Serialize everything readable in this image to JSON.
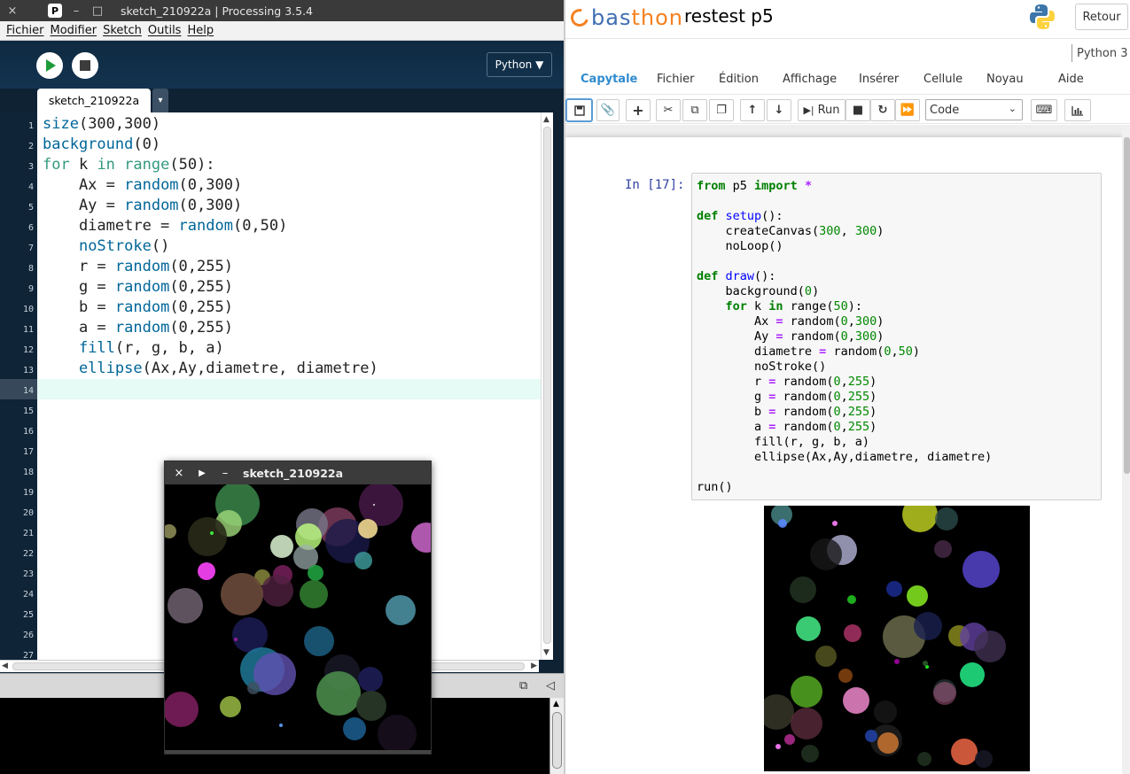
{
  "processing": {
    "window_title": "sketch_210922a | Processing 3.5.4",
    "logo_letter": "P",
    "titlebar_controls": [
      "×",
      "–",
      "□"
    ],
    "menu": [
      "Fichier",
      "Modifier",
      "Sketch",
      "Outils",
      "Help"
    ],
    "mode_label": "Python ▼",
    "tab_name": "sketch_210922a",
    "tab_arrow": "▾",
    "line_numbers": [
      "1",
      "2",
      "3",
      "4",
      "5",
      "6",
      "7",
      "8",
      "9",
      "10",
      "11",
      "12",
      "13",
      "14",
      "15",
      "16",
      "17",
      "18",
      "19",
      "20",
      "21",
      "22",
      "23",
      "24",
      "25",
      "26",
      "27"
    ],
    "code": [
      {
        "parts": [
          [
            "fn",
            "size"
          ],
          [
            "",
            "(300,300)"
          ]
        ]
      },
      {
        "parts": [
          [
            "fn",
            "background"
          ],
          [
            "",
            "(0)"
          ]
        ]
      },
      {
        "parts": [
          [
            "kw",
            "for"
          ],
          [
            "",
            " k "
          ],
          [
            "kw",
            "in"
          ],
          [
            "",
            " "
          ],
          [
            "kw",
            "range"
          ],
          [
            "",
            "(50):"
          ]
        ]
      },
      {
        "parts": [
          [
            "",
            "    Ax = "
          ],
          [
            "fn",
            "random"
          ],
          [
            "",
            "(0,300)"
          ]
        ]
      },
      {
        "parts": [
          [
            "",
            "    Ay = "
          ],
          [
            "fn",
            "random"
          ],
          [
            "",
            "(0,300)"
          ]
        ]
      },
      {
        "parts": [
          [
            "",
            "    diametre = "
          ],
          [
            "fn",
            "random"
          ],
          [
            "",
            "(0,50)"
          ]
        ]
      },
      {
        "parts": [
          [
            "",
            "    "
          ],
          [
            "fn",
            "noStroke"
          ],
          [
            "",
            "()"
          ]
        ]
      },
      {
        "parts": [
          [
            "",
            "    r = "
          ],
          [
            "fn",
            "random"
          ],
          [
            "",
            "(0,255)"
          ]
        ]
      },
      {
        "parts": [
          [
            "",
            "    g = "
          ],
          [
            "fn",
            "random"
          ],
          [
            "",
            "(0,255)"
          ]
        ]
      },
      {
        "parts": [
          [
            "",
            "    b = "
          ],
          [
            "fn",
            "random"
          ],
          [
            "",
            "(0,255)"
          ]
        ]
      },
      {
        "parts": [
          [
            "",
            "    a = "
          ],
          [
            "fn",
            "random"
          ],
          [
            "",
            "(0,255)"
          ]
        ]
      },
      {
        "parts": [
          [
            "",
            "    "
          ],
          [
            "fn",
            "fill"
          ],
          [
            "",
            "(r, g, b, a)"
          ]
        ]
      },
      {
        "parts": [
          [
            "",
            "    "
          ],
          [
            "fn",
            "ellipse"
          ],
          [
            "",
            "(Ax,Ay,diametre, diametre)"
          ]
        ]
      }
    ],
    "sketch_window_title": "sketch_210922a",
    "sketch_controls": [
      "×",
      "▶",
      "–"
    ],
    "console_icons": [
      "⧉",
      "◁"
    ]
  },
  "basthon": {
    "logo_part1": "bas",
    "logo_part2": "thon",
    "notebook_title": "restest p5",
    "retour_label": "Retour",
    "kernel": "Python 3",
    "menu": [
      {
        "label": "Capytale",
        "active": true
      },
      {
        "label": "Fichier"
      },
      {
        "label": "Édition"
      },
      {
        "label": "Affichage"
      },
      {
        "label": "Insérer"
      },
      {
        "label": "Cellule"
      },
      {
        "label": "Noyau"
      },
      {
        "label": "Aide"
      }
    ],
    "toolbar": {
      "run_label": "Run",
      "cell_type": "Code",
      "icons": [
        "save-icon",
        "paperclip-icon",
        "plus-icon",
        "cut-icon",
        "copy-icon",
        "paste-icon",
        "arrow-up-icon",
        "arrow-down-icon",
        "run-icon",
        "stop-icon",
        "restart-icon",
        "fast-forward-icon",
        "keyboard-icon",
        "chart-icon"
      ]
    },
    "prompt": "In [17]:",
    "cell_code": [
      [
        [
          "pk",
          "from"
        ],
        [
          "",
          " p5 "
        ],
        [
          "pk",
          "import"
        ],
        [
          "",
          " "
        ],
        [
          "po",
          "*"
        ]
      ],
      [],
      [
        [
          "pk",
          "def"
        ],
        [
          "",
          " "
        ],
        [
          "pf",
          "setup"
        ],
        [
          "",
          "():"
        ]
      ],
      [
        [
          "",
          "    createCanvas("
        ],
        [
          "pn",
          "300"
        ],
        [
          "",
          ", "
        ],
        [
          "pn",
          "300"
        ],
        [
          "",
          ")"
        ]
      ],
      [
        [
          "",
          "    noLoop()"
        ]
      ],
      [],
      [
        [
          "pk",
          "def"
        ],
        [
          "",
          " "
        ],
        [
          "pf",
          "draw"
        ],
        [
          "",
          "():"
        ]
      ],
      [
        [
          "",
          "    background("
        ],
        [
          "pn",
          "0"
        ],
        [
          "",
          ")"
        ]
      ],
      [
        [
          "",
          "    "
        ],
        [
          "pk",
          "for"
        ],
        [
          "",
          " k "
        ],
        [
          "pk",
          "in"
        ],
        [
          "",
          " range("
        ],
        [
          "pn",
          "50"
        ],
        [
          "",
          "):"
        ]
      ],
      [
        [
          "",
          "        Ax "
        ],
        [
          "po",
          "="
        ],
        [
          "",
          " random("
        ],
        [
          "pn",
          "0"
        ],
        [
          "",
          ","
        ],
        [
          "pn",
          "300"
        ],
        [
          "",
          ")"
        ]
      ],
      [
        [
          "",
          "        Ay "
        ],
        [
          "po",
          "="
        ],
        [
          "",
          " random("
        ],
        [
          "pn",
          "0"
        ],
        [
          "",
          ","
        ],
        [
          "pn",
          "300"
        ],
        [
          "",
          ")"
        ]
      ],
      [
        [
          "",
          "        diametre "
        ],
        [
          "po",
          "="
        ],
        [
          "",
          " random("
        ],
        [
          "pn",
          "0"
        ],
        [
          "",
          ","
        ],
        [
          "pn",
          "50"
        ],
        [
          "",
          ")"
        ]
      ],
      [
        [
          "",
          "        noStroke()"
        ]
      ],
      [
        [
          "",
          "        r "
        ],
        [
          "po",
          "="
        ],
        [
          "",
          " random("
        ],
        [
          "pn",
          "0"
        ],
        [
          "",
          ","
        ],
        [
          "pn",
          "255"
        ],
        [
          "",
          ")"
        ]
      ],
      [
        [
          "",
          "        g "
        ],
        [
          "po",
          "="
        ],
        [
          "",
          " random("
        ],
        [
          "pn",
          "0"
        ],
        [
          "",
          ","
        ],
        [
          "pn",
          "255"
        ],
        [
          "",
          ")"
        ]
      ],
      [
        [
          "",
          "        b "
        ],
        [
          "po",
          "="
        ],
        [
          "",
          " random("
        ],
        [
          "pn",
          "0"
        ],
        [
          "",
          ","
        ],
        [
          "pn",
          "255"
        ],
        [
          "",
          ")"
        ]
      ],
      [
        [
          "",
          "        a "
        ],
        [
          "po",
          "="
        ],
        [
          "",
          " random("
        ],
        [
          "pn",
          "0"
        ],
        [
          "",
          ","
        ],
        [
          "pn",
          "255"
        ],
        [
          "",
          ")"
        ]
      ],
      [
        [
          "",
          "        fill(r, g, b, a)"
        ]
      ],
      [
        [
          "",
          "        ellipse(Ax,Ay,diametre, diametre)"
        ]
      ],
      [],
      [
        [
          "",
          "run()"
        ]
      ]
    ]
  },
  "colors": {
    "processing_bg": "#0e2234",
    "keyword": "#33997e",
    "function": "#006699",
    "run_green": "#1f9b3a",
    "basthon_blue": "#3f6eb2",
    "basthon_orange": "#f48120",
    "active_menu": "#2f8bce"
  },
  "sketch_circles": [
    [
      82,
      22,
      25,
      "#3f8f4f",
      0.8
    ],
    [
      72,
      44,
      15,
      "#9fd87a",
      0.8
    ],
    [
      195,
      48,
      22,
      "#7a3a5a",
      0.85
    ],
    [
      244,
      22,
      25,
      "#4a1a4a",
      0.8
    ],
    [
      166,
      45,
      18,
      "#777788",
      0.8
    ],
    [
      206,
      64,
      25,
      "#1a1a4a",
      0.8
    ],
    [
      229,
      50,
      11,
      "#f0d890",
      0.9
    ],
    [
      295,
      60,
      17,
      "#c060c0",
      0.9
    ],
    [
      48,
      59,
      22,
      "#2a2a1a",
      0.9
    ],
    [
      5,
      53,
      8,
      "#888855",
      0.9
    ],
    [
      132,
      70,
      13,
      "#d0e8c8",
      0.9
    ],
    [
      162,
      59,
      15,
      "#c0ff80",
      0.8
    ],
    [
      159,
      82,
      14,
      "#a0b0b0",
      0.7
    ],
    [
      170,
      100,
      9,
      "#20a040",
      0.9
    ],
    [
      47,
      98,
      10,
      "#f040f0",
      0.95
    ],
    [
      224,
      86,
      10,
      "#40a0a0",
      0.8
    ],
    [
      23,
      137,
      20,
      "#706070",
      0.85
    ],
    [
      110,
      105,
      9,
      "#909040",
      0.8
    ],
    [
      133,
      102,
      11,
      "#802060",
      0.8
    ],
    [
      127,
      120,
      18,
      "#502040",
      0.8
    ],
    [
      168,
      124,
      16,
      "#2f7a2f",
      0.9
    ],
    [
      87,
      124,
      24,
      "#6a4a3a",
      0.9
    ],
    [
      96,
      170,
      20,
      "#1a1a50",
      0.9
    ],
    [
      266,
      142,
      17,
      "#4a8ea0",
      0.9
    ],
    [
      174,
      177,
      17,
      "#1a5a7a",
      0.9
    ],
    [
      110,
      209,
      25,
      "#2080a0",
      0.8
    ],
    [
      124,
      214,
      24,
      "#6050b0",
      0.8
    ],
    [
      200,
      212,
      20,
      "#1a1a2a",
      0.8
    ],
    [
      232,
      220,
      14,
      "#202060",
      0.8
    ],
    [
      196,
      236,
      25,
      "#4a8a4a",
      0.9
    ],
    [
      233,
      250,
      17,
      "#2a3a2a",
      0.9
    ],
    [
      214,
      276,
      13,
      "#1a5a8a",
      0.9
    ],
    [
      18,
      254,
      20,
      "#802060",
      0.85
    ],
    [
      74,
      251,
      12,
      "#90b040",
      0.9
    ],
    [
      262,
      282,
      22,
      "#1a1020",
      0.8
    ],
    [
      100,
      230,
      7,
      "#405060",
      0.8
    ],
    [
      131,
      272,
      2,
      "#60a0ff",
      0.9
    ],
    [
      80,
      175,
      2,
      "#a020a0",
      0.9
    ],
    [
      53,
      55,
      2,
      "#40ff40",
      0.9
    ],
    [
      236,
      23,
      1,
      "#ffffff",
      0.9
    ]
  ],
  "output_circles": [
    [
      20,
      10,
      12,
      "#4a8a8a",
      0.8
    ],
    [
      176,
      10,
      20,
      "#b0c020",
      0.9
    ],
    [
      206,
      15,
      13,
      "#2a4a4a",
      0.8
    ],
    [
      80,
      20,
      3,
      "#ff80ff",
      0.9
    ],
    [
      88,
      50,
      17,
      "#a0a0c0",
      0.9
    ],
    [
      202,
      49,
      10,
      "#4a2a4a",
      0.8
    ],
    [
      245,
      72,
      21,
      "#5040c0",
      0.9
    ],
    [
      70,
      55,
      18,
      "#181818",
      0.8
    ],
    [
      44,
      95,
      15,
      "#203020",
      0.9
    ],
    [
      147,
      94,
      9,
      "#1a2a8a",
      0.9
    ],
    [
      173,
      102,
      12,
      "#80e020",
      0.9
    ],
    [
      99,
      106,
      5,
      "#20c020",
      0.9
    ],
    [
      50,
      139,
      14,
      "#40e080",
      0.9
    ],
    [
      158,
      148,
      24,
      "#707050",
      0.8
    ],
    [
      185,
      136,
      16,
      "#1a2050",
      0.8
    ],
    [
      100,
      144,
      10,
      "#a03060",
      0.9
    ],
    [
      220,
      147,
      12,
      "#909020",
      0.8
    ],
    [
      237,
      148,
      16,
      "#6040a0",
      0.8
    ],
    [
      255,
      159,
      18,
      "#403050",
      0.8
    ],
    [
      70,
      170,
      12,
      "#505020",
      0.9
    ],
    [
      92,
      192,
      8,
      "#804010",
      0.9
    ],
    [
      48,
      210,
      18,
      "#50a020",
      0.9
    ],
    [
      204,
      209,
      13,
      "#202a2a",
      0.9
    ],
    [
      235,
      191,
      14,
      "#20e080",
      0.9
    ],
    [
      104,
      220,
      15,
      "#e080c0",
      0.9
    ],
    [
      137,
      233,
      13,
      "#181818",
      0.8
    ],
    [
      14,
      233,
      20,
      "#3a3a2a",
      0.8
    ],
    [
      48,
      246,
      18,
      "#5a2a3a",
      0.8
    ],
    [
      138,
      265,
      18,
      "#202020",
      0.8
    ],
    [
      140,
      268,
      12,
      "#c07030",
      0.9
    ],
    [
      204,
      212,
      13,
      "#ff80c0",
      0.35
    ],
    [
      121,
      260,
      7,
      "#2040a0",
      0.9
    ],
    [
      29,
      264,
      6,
      "#aa2a8a",
      0.9
    ],
    [
      52,
      280,
      10,
      "#203020",
      0.9
    ],
    [
      181,
      286,
      8,
      "#203020",
      0.9
    ],
    [
      226,
      278,
      15,
      "#e06040",
      0.9
    ],
    [
      248,
      286,
      10,
      "#1a1a2a",
      0.8
    ],
    [
      21,
      20,
      5,
      "#5a8aff",
      0.9
    ],
    [
      184,
      182,
      2,
      "#20ff20",
      0.9
    ],
    [
      16,
      272,
      3,
      "#ff80ff",
      0.9
    ],
    [
      150,
      176,
      3,
      "#a000a0",
      0.9
    ],
    [
      182,
      178,
      3,
      "#2a5a2a",
      0.9
    ]
  ]
}
